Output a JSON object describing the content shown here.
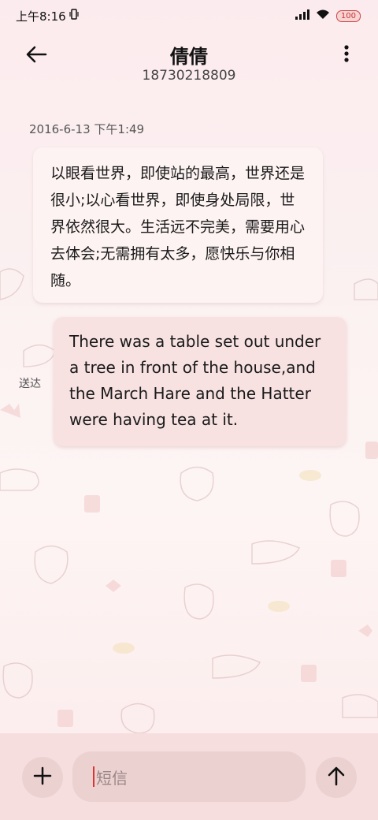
{
  "status_bar": {
    "time": "上午8:16",
    "battery": "100",
    "icons": [
      "vibrate-icon",
      "signal-icon",
      "wifi-icon",
      "battery-icon"
    ]
  },
  "header": {
    "contact_name": "倩倩",
    "contact_number": "18730218809",
    "back_icon": "arrow-left-icon",
    "menu_icon": "more-vertical-icon"
  },
  "conversation": {
    "timestamp": "2016-6-13 下午1:49",
    "messages": [
      {
        "direction": "incoming",
        "text": "以眼看世界，即使站的最高，世界还是很小;以心看世界，即使身处局限，世界依然很大。生活远不完美，需要用心去体会;无需拥有太多，愿快乐与你相随。"
      },
      {
        "direction": "outgoing",
        "text": "There was a table set out under a tree in front of the house,and the March Hare and the Hatter were having tea at it.",
        "status": "送达"
      }
    ]
  },
  "composer": {
    "placeholder": "短信",
    "add_icon": "plus-icon",
    "send_icon": "arrow-up-icon"
  },
  "colors": {
    "background": "#fcebee",
    "incoming_bubble": "#fdf3f2",
    "outgoing_bubble": "#f7e1e1",
    "bottom_bar": "#f6dede"
  }
}
